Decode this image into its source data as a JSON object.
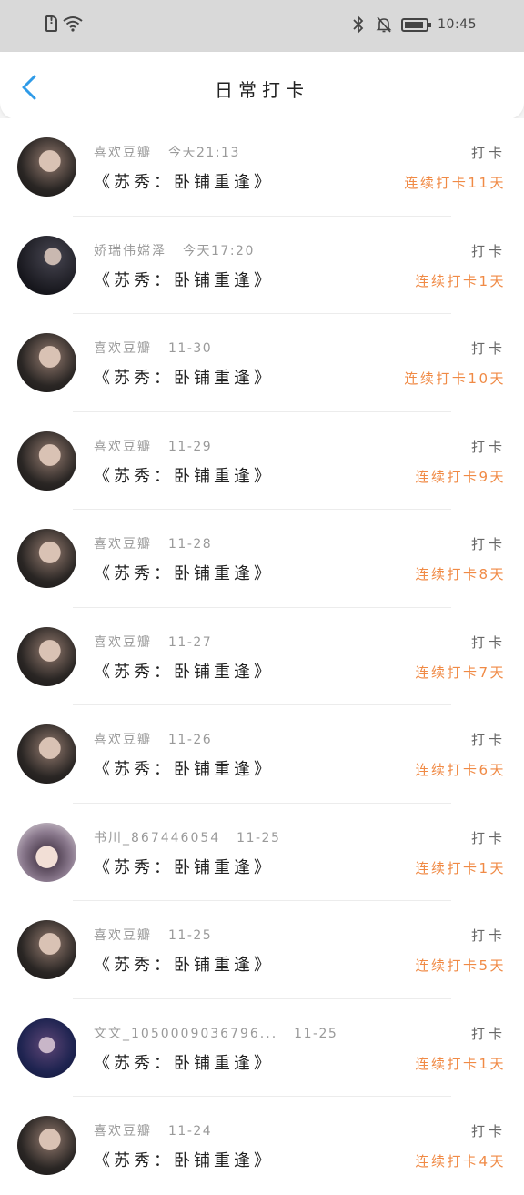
{
  "status_bar": {
    "time": "10:45",
    "icons": [
      "sim-alert-icon",
      "wifi-icon",
      "bluetooth-icon",
      "mute-bell-icon",
      "battery-icon"
    ]
  },
  "header": {
    "title": "日常打卡",
    "back_icon": "chevron-left-icon"
  },
  "colors": {
    "accent": "#2f9be8",
    "streak": "#f08a45",
    "meta": "#9a9a9a"
  },
  "records": [
    {
      "user": "喜欢豆瓣",
      "time": "今天21:13",
      "book": "《苏秀：卧铺重逢》",
      "action": "打卡",
      "streak": "连续打卡11天",
      "avatar": "dark"
    },
    {
      "user": "娇瑞伟嫦泽",
      "time": "今天17:20",
      "book": "《苏秀：卧铺重逢》",
      "action": "打卡",
      "streak": "连续打卡1天",
      "avatar": "night"
    },
    {
      "user": "喜欢豆瓣",
      "time": "11-30",
      "book": "《苏秀：卧铺重逢》",
      "action": "打卡",
      "streak": "连续打卡10天",
      "avatar": "dark"
    },
    {
      "user": "喜欢豆瓣",
      "time": "11-29",
      "book": "《苏秀：卧铺重逢》",
      "action": "打卡",
      "streak": "连续打卡9天",
      "avatar": "dark"
    },
    {
      "user": "喜欢豆瓣",
      "time": "11-28",
      "book": "《苏秀：卧铺重逢》",
      "action": "打卡",
      "streak": "连续打卡8天",
      "avatar": "dark"
    },
    {
      "user": "喜欢豆瓣",
      "time": "11-27",
      "book": "《苏秀：卧铺重逢》",
      "action": "打卡",
      "streak": "连续打卡7天",
      "avatar": "dark"
    },
    {
      "user": "喜欢豆瓣",
      "time": "11-26",
      "book": "《苏秀：卧铺重逢》",
      "action": "打卡",
      "streak": "连续打卡6天",
      "avatar": "dark"
    },
    {
      "user": "书川_867446054",
      "time": "11-25",
      "book": "《苏秀：卧铺重逢》",
      "action": "打卡",
      "streak": "连续打卡1天",
      "avatar": "anime"
    },
    {
      "user": "喜欢豆瓣",
      "time": "11-25",
      "book": "《苏秀：卧铺重逢》",
      "action": "打卡",
      "streak": "连续打卡5天",
      "avatar": "dark"
    },
    {
      "user": "文文_1050009036796...",
      "time": "11-25",
      "book": "《苏秀：卧铺重逢》",
      "action": "打卡",
      "streak": "连续打卡1天",
      "avatar": "blue"
    },
    {
      "user": "喜欢豆瓣",
      "time": "11-24",
      "book": "《苏秀：卧铺重逢》",
      "action": "打卡",
      "streak": "连续打卡4天",
      "avatar": "dark"
    }
  ]
}
